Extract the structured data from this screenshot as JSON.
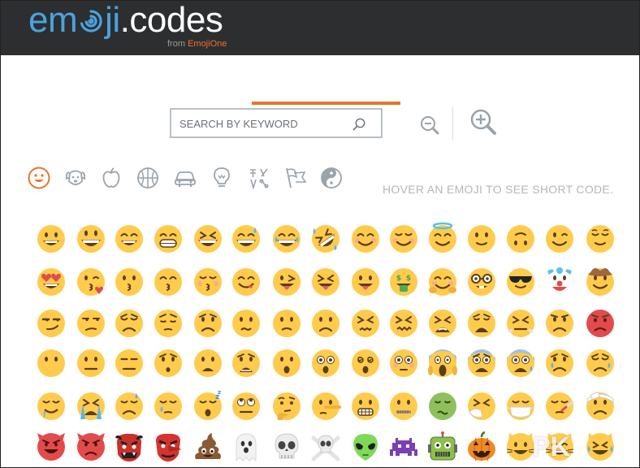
{
  "header": {
    "logo_em": "em",
    "logo_ji": "ji",
    "logo_codes": ".codes",
    "from_label": "from",
    "from_brand": "EmojiOne"
  },
  "search": {
    "placeholder": "SEARCH BY KEYWORD",
    "value": ""
  },
  "icons": {
    "search": "search-icon",
    "zoom_out": "zoom-out-icon",
    "zoom_in": "zoom-in-icon"
  },
  "categories": [
    {
      "name": "people",
      "icon": "smiley-icon",
      "active": true
    },
    {
      "name": "nature",
      "icon": "dog-icon",
      "active": false
    },
    {
      "name": "food",
      "icon": "apple-icon",
      "active": false
    },
    {
      "name": "activity",
      "icon": "basketball-icon",
      "active": false
    },
    {
      "name": "travel",
      "icon": "car-icon",
      "active": false
    },
    {
      "name": "objects",
      "icon": "lightbulb-icon",
      "active": false
    },
    {
      "name": "symbols",
      "icon": "symbols-icon",
      "active": false
    },
    {
      "name": "flags",
      "icon": "flags-icon",
      "active": false
    },
    {
      "name": "yin-yang",
      "icon": "yin-yang-icon",
      "active": false
    }
  ],
  "hover_hint": "HOVER AN EMOJI TO SEE SHORT CODE.",
  "colors": {
    "header_bg": "#2d2e30",
    "accent": "#e8742a",
    "logo_blue": "#4aa3df",
    "emoji_yellow": "#ffcb4c",
    "emoji_red": "#e24b4b",
    "icon_gray": "#9aa3ab"
  },
  "emoji_rows": [
    [
      "grinning",
      "smiley",
      "smile",
      "grin",
      "laughing",
      "sweat-smile",
      "joy",
      "rofl",
      "blush",
      "relaxed",
      "innocent",
      "slight-smile",
      "upside-down",
      "wink",
      "relieved"
    ],
    [
      "heart-eyes",
      "kissing-heart",
      "kissing",
      "kissing-smiling-eyes",
      "kissing-closed-eyes",
      "yum",
      "stuck-out-tongue-winking",
      "stuck-out-tongue-closed-eyes",
      "stuck-out-tongue",
      "money-mouth",
      "hugging",
      "nerd",
      "sunglasses",
      "clown",
      "cowboy"
    ],
    [
      "smirk",
      "unamused",
      "disappointed",
      "pensive",
      "worried",
      "confused",
      "slight-frown",
      "frowning2",
      "persevere",
      "confounded",
      "tired-face",
      "weary",
      "triumph",
      "angry",
      "rage"
    ],
    [
      "no-mouth",
      "neutral-face",
      "expressionless",
      "hushed",
      "frowning",
      "anguished",
      "open-mouth",
      "astonished",
      "dizzy-face",
      "flushed",
      "scream",
      "fearful",
      "cold-sweat",
      "cry",
      "disappointed-relieved"
    ],
    [
      "drooling-face",
      "sob",
      "sweat",
      "sleepy",
      "sleeping",
      "rolling-eyes",
      "thinking",
      "lying-face",
      "grimacing",
      "zipper-mouth",
      "nauseated-face",
      "sneezing-face",
      "mask",
      "thermometer-face",
      "head-bandage"
    ],
    [
      "smiling-imp",
      "imp",
      "japanese-ogre",
      "japanese-goblin",
      "poop",
      "ghost",
      "skull",
      "skull-crossbones",
      "alien",
      "space-invader",
      "robot",
      "jack-o-lantern",
      "smiley-cat",
      "smile-cat",
      "joy-cat"
    ]
  ],
  "watermark": "PK"
}
